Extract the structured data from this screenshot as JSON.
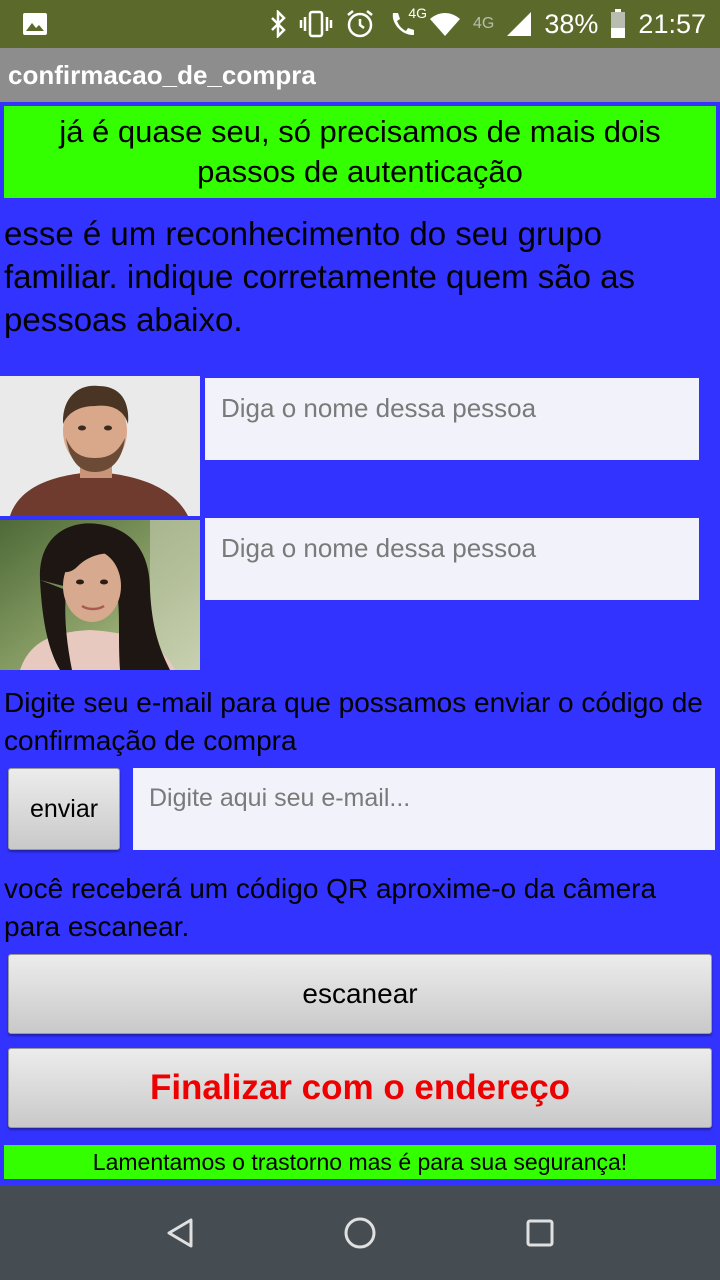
{
  "status_bar": {
    "network_label": "4G",
    "call_label": "4G",
    "battery": "38%",
    "time": "21:57",
    "icons": [
      "image-icon",
      "bluetooth-icon",
      "vibrate-icon",
      "alarm-icon",
      "call-4g-icon",
      "wifi-icon",
      "signal-icon",
      "battery-icon"
    ]
  },
  "app_bar": {
    "title": "confirmacao_de_compra"
  },
  "banner": {
    "text": "já é quase seu, só precisamos de mais dois passos de autenticação"
  },
  "intro": {
    "text": "esse é um reconhecimento do seu grupo familiar. indique corretamente quem são as pessoas abaixo."
  },
  "persons": [
    {
      "placeholder": "Diga o nome dessa pessoa"
    },
    {
      "placeholder": "Diga o nome dessa pessoa"
    }
  ],
  "email": {
    "instruction": "Digite seu e-mail para que possamos enviar o código de confirmação de compra",
    "send_label": "enviar",
    "placeholder": "Digite aqui seu e-mail..."
  },
  "qr": {
    "instruction": "você receberá um código QR aproxime-o da câmera para escanear."
  },
  "actions": {
    "scan_label": "escanear",
    "finalize_label": "Finalizar com o endereço"
  },
  "footer": {
    "text": "Lamentamos o trastorno mas é para sua segurança!"
  },
  "colors": {
    "background": "#3333ff",
    "banner": "#33ff00",
    "finalize_text": "#ee0000",
    "status_bar": "#5b6a2a",
    "app_bar": "#8d8d8d",
    "nav_bar": "#454c52"
  },
  "nav_bar": {
    "icons": [
      "back-icon",
      "home-icon",
      "recents-icon"
    ]
  }
}
